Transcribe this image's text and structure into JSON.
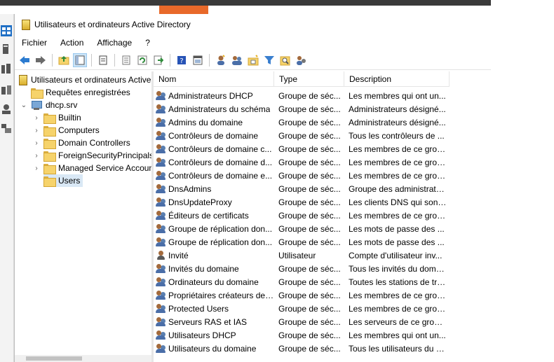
{
  "window": {
    "title": "Utilisateurs et ordinateurs Active Directory"
  },
  "menu": [
    "Fichier",
    "Action",
    "Affichage",
    "?"
  ],
  "toolbar": {
    "icons": [
      "back-icon",
      "forward-icon",
      "up-folder-icon",
      "show-tree-icon",
      "copy-icon",
      "properties-icon",
      "refresh-icon",
      "export-icon",
      "help-icon",
      "console-icon",
      "new-user-icon",
      "new-group-icon",
      "new-ou-icon",
      "filter-icon",
      "find-icon",
      "add-to-group-icon"
    ]
  },
  "tree": {
    "root": "Utilisateurs et ordinateurs Active",
    "saved_queries": "Requêtes enregistrées",
    "domain": "dhcp.srv",
    "children": [
      "Builtin",
      "Computers",
      "Domain Controllers",
      "ForeignSecurityPrincipals",
      "Managed Service Accounts",
      "Users"
    ],
    "selected": "Users"
  },
  "list": {
    "columns": [
      "Nom",
      "Type",
      "Description"
    ],
    "rows": [
      {
        "icon": "group-icon",
        "name": "Administrateurs DHCP",
        "type": "Groupe de séc...",
        "desc": "Les membres qui ont un..."
      },
      {
        "icon": "group-icon",
        "name": "Administrateurs du schéma",
        "type": "Groupe de séc...",
        "desc": "Administrateurs désigné..."
      },
      {
        "icon": "group-icon",
        "name": "Admins du domaine",
        "type": "Groupe de séc...",
        "desc": "Administrateurs désigné..."
      },
      {
        "icon": "group-icon",
        "name": "Contrôleurs de domaine",
        "type": "Groupe de séc...",
        "desc": "Tous les contrôleurs de ..."
      },
      {
        "icon": "group-icon",
        "name": "Contrôleurs de domaine c...",
        "type": "Groupe de séc...",
        "desc": "Les membres de ce grou..."
      },
      {
        "icon": "group-icon",
        "name": "Contrôleurs de domaine d...",
        "type": "Groupe de séc...",
        "desc": "Les membres de ce grou..."
      },
      {
        "icon": "group-icon",
        "name": "Contrôleurs de domaine e...",
        "type": "Groupe de séc...",
        "desc": "Les membres de ce grou..."
      },
      {
        "icon": "group-icon",
        "name": "DnsAdmins",
        "type": "Groupe de séc...",
        "desc": "Groupe des administrate..."
      },
      {
        "icon": "group-icon",
        "name": "DnsUpdateProxy",
        "type": "Groupe de séc...",
        "desc": "Les clients DNS qui sont ..."
      },
      {
        "icon": "group-icon",
        "name": "Éditeurs de certificats",
        "type": "Groupe de séc...",
        "desc": "Les membres de ce grou..."
      },
      {
        "icon": "group-icon",
        "name": "Groupe de réplication don...",
        "type": "Groupe de séc...",
        "desc": "Les mots de passe des ..."
      },
      {
        "icon": "group-icon",
        "name": "Groupe de réplication don...",
        "type": "Groupe de séc...",
        "desc": "Les mots de passe des ..."
      },
      {
        "icon": "user-icon",
        "name": "Invité",
        "type": "Utilisateur",
        "desc": "Compte d'utilisateur inv..."
      },
      {
        "icon": "group-icon",
        "name": "Invités du domaine",
        "type": "Groupe de séc...",
        "desc": "Tous les invités du doma..."
      },
      {
        "icon": "group-icon",
        "name": "Ordinateurs du domaine",
        "type": "Groupe de séc...",
        "desc": "Toutes les stations de tra..."
      },
      {
        "icon": "group-icon",
        "name": "Propriétaires créateurs de ...",
        "type": "Groupe de séc...",
        "desc": "Les membres de ce grou..."
      },
      {
        "icon": "group-icon",
        "name": "Protected Users",
        "type": "Groupe de séc...",
        "desc": "Les membres de ce grou..."
      },
      {
        "icon": "group-icon",
        "name": "Serveurs RAS et IAS",
        "type": "Groupe de séc...",
        "desc": "Les serveurs de ce group..."
      },
      {
        "icon": "group-icon",
        "name": "Utilisateurs DHCP",
        "type": "Groupe de séc...",
        "desc": "Les membres qui ont un..."
      },
      {
        "icon": "group-icon",
        "name": "Utilisateurs du domaine",
        "type": "Groupe de séc...",
        "desc": "Tous les utilisateurs du d..."
      }
    ]
  },
  "colors": {
    "accent_orange": "#e8692a",
    "selection": "#d9e8f5",
    "folder": "#f6d36b"
  }
}
